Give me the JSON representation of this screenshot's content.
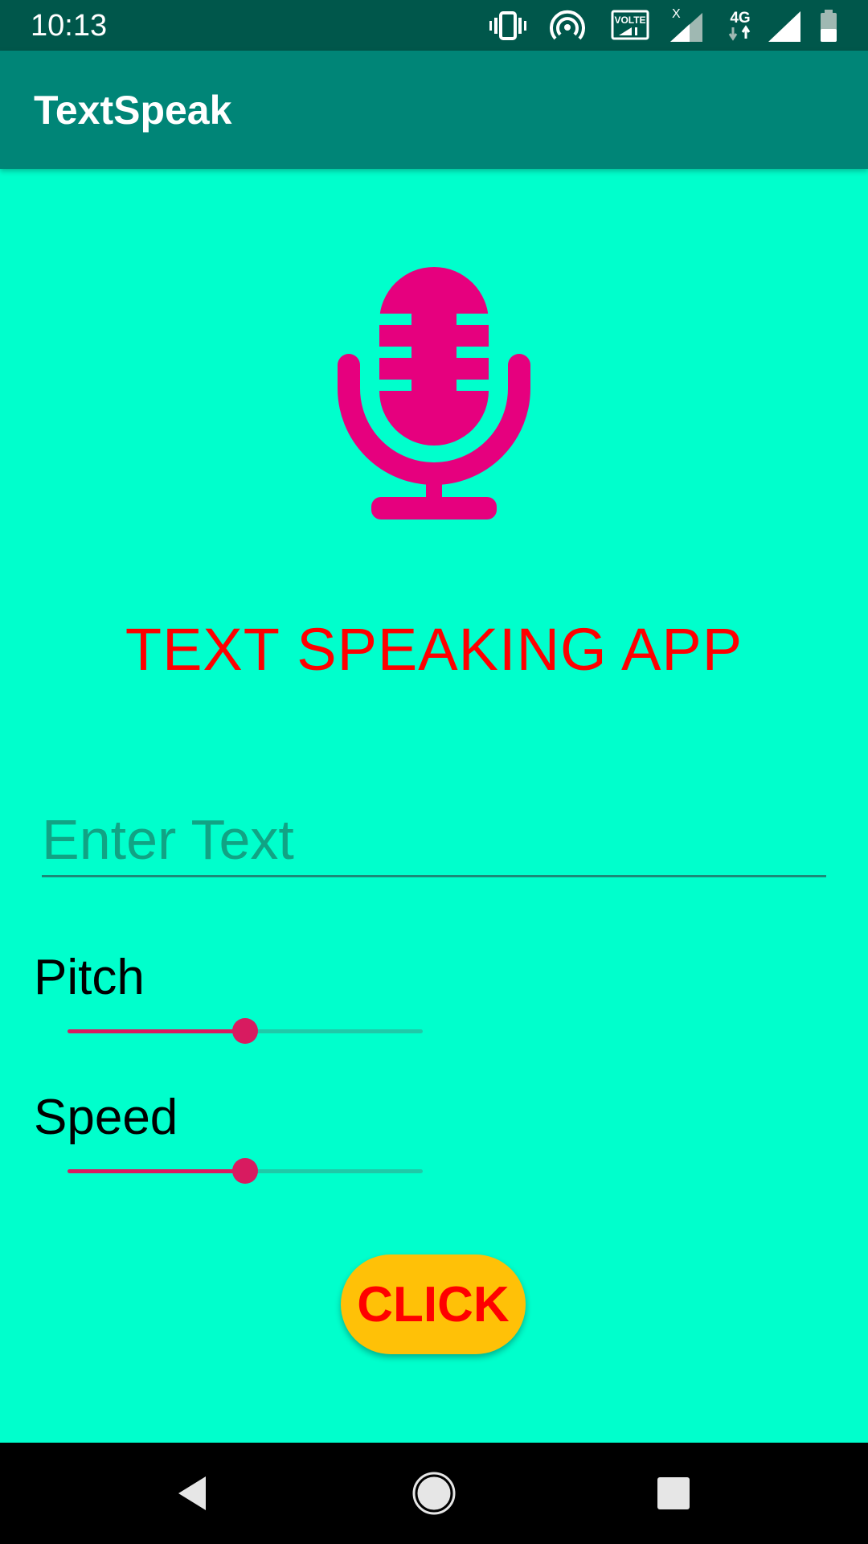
{
  "status_bar": {
    "time": "10:13",
    "icons": [
      "vibrate-icon",
      "hotspot-icon",
      "volte-icon",
      "signal-x-icon",
      "network-4g-icon",
      "signal-icon",
      "battery-icon"
    ],
    "volte_text": "VOLTE",
    "network_text": "4G",
    "sim_no_signal_mark": "X",
    "battery_level": 0.45
  },
  "app_bar": {
    "title": "TextSpeak"
  },
  "main": {
    "mic_icon": "microphone-icon",
    "heading": "TEXT SPEAKING APP",
    "text_input": {
      "value": "",
      "placeholder": "Enter Text"
    },
    "pitch": {
      "label": "Pitch",
      "value": 0.5
    },
    "speed": {
      "label": "Speed",
      "value": 0.5
    },
    "button_label": "CLICK"
  },
  "nav_bar": {
    "icons": [
      "back-icon",
      "home-icon",
      "recents-icon"
    ]
  },
  "colors": {
    "status_bar": "#00574B",
    "app_bar": "#008577",
    "background": "#00FFCC",
    "accent": "#D81B60",
    "mic": "#E6007E",
    "heading": "#FF0000",
    "button": "#FFC107",
    "button_text": "#FF0000"
  }
}
